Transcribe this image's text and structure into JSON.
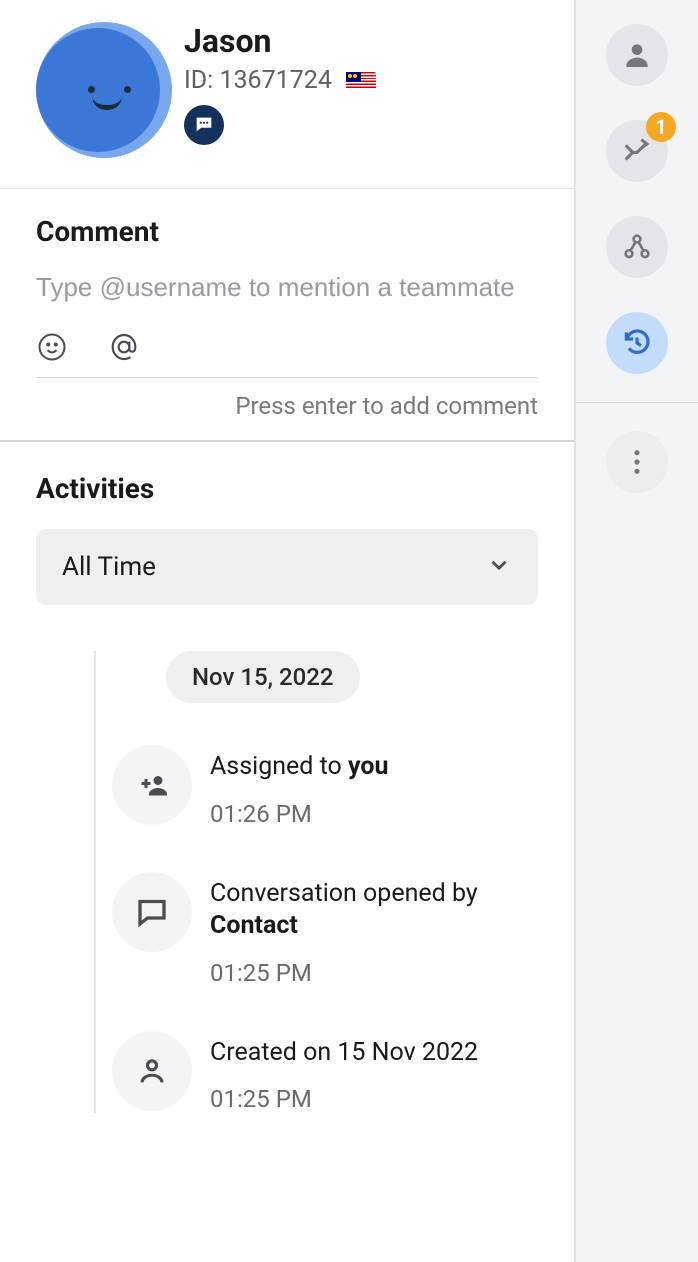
{
  "profile": {
    "name": "Jason",
    "id_label": "ID: 13671724",
    "country_flag": "Malaysia"
  },
  "comment": {
    "heading": "Comment",
    "placeholder": "Type @username to mention a teammate",
    "hint": "Press enter to add comment"
  },
  "activities": {
    "heading": "Activities",
    "filter_selected": "All Time",
    "date_group": "Nov 15, 2022",
    "items": [
      {
        "prefix": "Assigned to ",
        "bold": "you",
        "suffix": "",
        "time": "01:26 PM",
        "icon": "person-add"
      },
      {
        "prefix": "Conversation opened by ",
        "bold": "Contact",
        "suffix": "",
        "time": "01:25 PM",
        "icon": "chat"
      },
      {
        "prefix": "Created on 15 Nov 2022",
        "bold": "",
        "suffix": "",
        "time": "01:25 PM",
        "icon": "person"
      }
    ]
  },
  "rightbar": {
    "notification_count": "1"
  }
}
